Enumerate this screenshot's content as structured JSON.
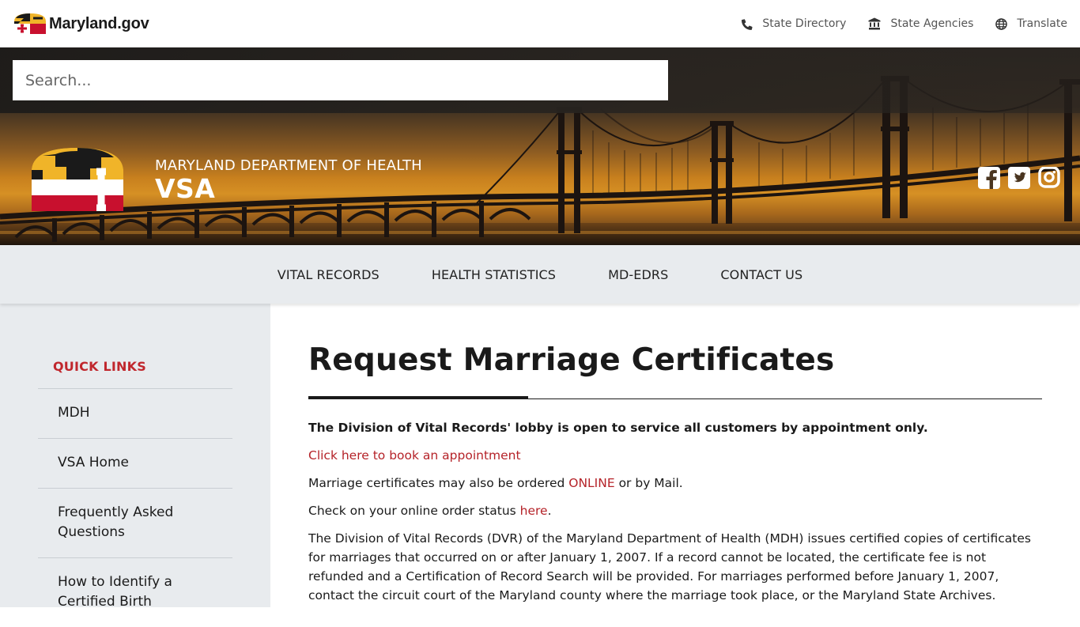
{
  "topbar": {
    "brand": "Maryland.gov",
    "links": [
      {
        "label": "State Directory",
        "icon": "phone-icon"
      },
      {
        "label": "State Agencies",
        "icon": "bank-icon"
      },
      {
        "label": "Translate",
        "icon": "globe-icon"
      }
    ]
  },
  "search": {
    "placeholder": "Search..."
  },
  "agency": {
    "department": "MARYLAND DEPARTMENT OF HEALTH",
    "name": "VSA"
  },
  "social": [
    "facebook-icon",
    "twitter-icon",
    "instagram-icon"
  ],
  "nav": [
    "VITAL RECORDS",
    "HEALTH STATISTICS",
    "MD-EDRS",
    "CONTACT US"
  ],
  "sidebar": {
    "title": "QUICK LINKS",
    "items": [
      "MDH",
      "VSA Home",
      "Frequently Asked Questions",
      "How to Identify a Certified Birth"
    ]
  },
  "content": {
    "title": "Request Marriage Certificates",
    "lobby_notice": "The Division of Vital Records' lobby is open to service all customers by appointment only.",
    "appointment_link": "Click here to book an appointment",
    "order_text_1": "Marriage certificates may also be ordered ",
    "order_link": "ONLINE",
    "order_text_2": " or by Mail.",
    "status_text": "Check on your online order status ",
    "status_link": "here",
    "status_end": ".",
    "description": "The Division of Vital Records (DVR) of the Maryland Department of Health (MDH) issues certified copies of certificates for marriages that occurred on or after January 1, 2007. If a record cannot be located, the certificate fee is not refunded and a Certification of Record Search will be provided. For marriages performed before January 1, 2007, contact the circuit court of the Maryland county where the marriage took place, or the Maryland State Archives."
  },
  "colors": {
    "accent_red": "#b52329",
    "sidebar_bg": "#e8ebee",
    "flag_gold": "#f0b429",
    "flag_red": "#c8102e"
  }
}
